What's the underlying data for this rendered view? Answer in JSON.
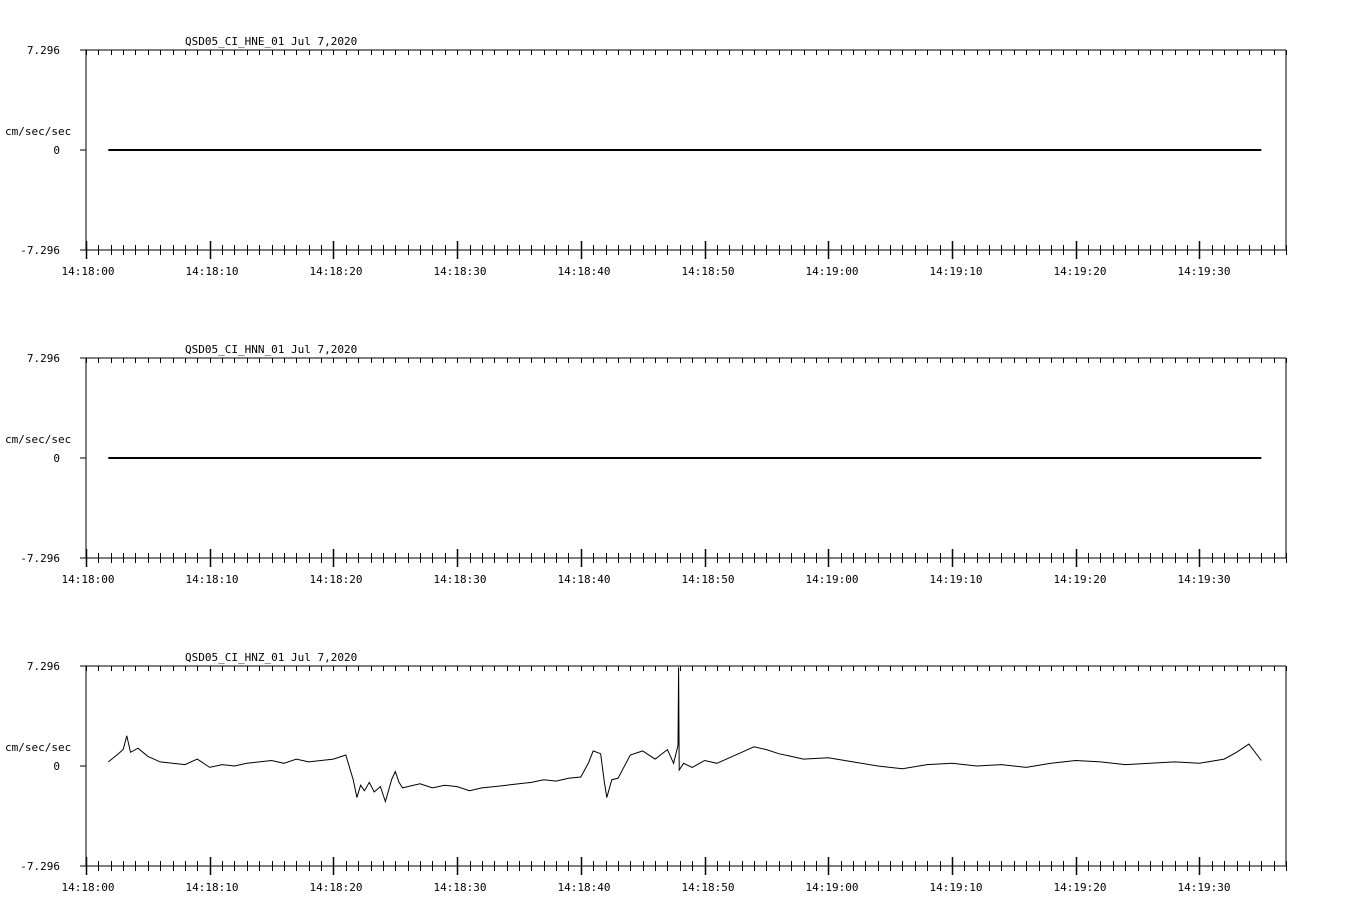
{
  "chart_data": [
    {
      "type": "line",
      "title": "QSD05_CI_HNE_01  Jul 7,2020",
      "ylabel": "cm/sec/sec",
      "y_tick_labels": [
        "7.296",
        "0",
        "-7.296"
      ],
      "ylim": [
        -7.296,
        7.296
      ],
      "x_tick_labels": [
        "14:18:00",
        "14:18:10",
        "14:18:20",
        "14:18:30",
        "14:18:40",
        "14:18:50",
        "14:19:00",
        "14:19:10",
        "14:19:20",
        "14:19:30"
      ],
      "x_range_s": [
        0,
        97
      ],
      "series": [
        {
          "x": [
            1.8,
            95.0
          ],
          "y": [
            0,
            0
          ]
        }
      ],
      "line_color": "#000000",
      "grid": false
    },
    {
      "type": "line",
      "title": "QSD05_CI_HNN_01  Jul 7,2020",
      "ylabel": "cm/sec/sec",
      "y_tick_labels": [
        "7.296",
        "0",
        "-7.296"
      ],
      "ylim": [
        -7.296,
        7.296
      ],
      "x_tick_labels": [
        "14:18:00",
        "14:18:10",
        "14:18:20",
        "14:18:30",
        "14:18:40",
        "14:18:50",
        "14:19:00",
        "14:19:10",
        "14:19:20",
        "14:19:30"
      ],
      "x_range_s": [
        0,
        97
      ],
      "series": [
        {
          "x": [
            1.8,
            95.0
          ],
          "y": [
            0,
            0
          ]
        }
      ],
      "line_color": "#000000",
      "grid": false
    },
    {
      "type": "line",
      "title": "QSD05_CI_HNZ_01  Jul 7,2020",
      "ylabel": "cm/sec/sec",
      "y_tick_labels": [
        "7.296",
        "0",
        "-7.296"
      ],
      "ylim": [
        -7.296,
        7.296
      ],
      "x_tick_labels": [
        "14:18:00",
        "14:18:10",
        "14:18:20",
        "14:18:30",
        "14:18:40",
        "14:18:50",
        "14:19:00",
        "14:19:10",
        "14:19:20",
        "14:19:30"
      ],
      "x_range_s": [
        0,
        97
      ],
      "series": [
        {
          "x": [
            1.8,
            2.5,
            3.0,
            3.3,
            3.6,
            4.2,
            5.0,
            6.0,
            7.0,
            8.0,
            9.0,
            10.0,
            11.0,
            12.0,
            13.0,
            14.0,
            15.0,
            16.0,
            17.0,
            18.0,
            19.0,
            20.0,
            21.0,
            21.6,
            21.9,
            22.2,
            22.5,
            22.9,
            23.3,
            23.8,
            24.2,
            24.7,
            25.0,
            25.3,
            25.6,
            26.0,
            27.0,
            28.0,
            29.0,
            30.0,
            31.0,
            32.0,
            33.0,
            34.0,
            35.0,
            36.0,
            37.0,
            38.0,
            39.0,
            40.0,
            40.6,
            41.0,
            41.6,
            41.9,
            42.1,
            42.5,
            43.0,
            44.0,
            45.0,
            46.0,
            47.0,
            47.5,
            47.85,
            47.9,
            47.95,
            48.3,
            49.0,
            50.0,
            51.0,
            52.0,
            53.0,
            54.0,
            55.0,
            56.0,
            57.0,
            58.0,
            60.0,
            62.0,
            64.0,
            66.0,
            68.0,
            70.0,
            72.0,
            74.0,
            76.0,
            78.0,
            80.0,
            82.0,
            84.0,
            86.0,
            88.0,
            90.0,
            92.0,
            93.0,
            94.0,
            95.0
          ],
          "y": [
            0.3,
            0.8,
            1.2,
            2.2,
            1.0,
            1.3,
            0.7,
            0.3,
            0.2,
            0.1,
            0.5,
            -0.1,
            0.1,
            0.0,
            0.2,
            0.3,
            0.4,
            0.2,
            0.5,
            0.3,
            0.4,
            0.5,
            0.8,
            -1.0,
            -2.3,
            -1.4,
            -1.8,
            -1.2,
            -1.9,
            -1.5,
            -2.6,
            -1.0,
            -0.4,
            -1.2,
            -1.6,
            -1.5,
            -1.3,
            -1.6,
            -1.4,
            -1.5,
            -1.8,
            -1.6,
            -1.5,
            -1.4,
            -1.3,
            -1.2,
            -1.0,
            -1.1,
            -0.9,
            -0.8,
            0.2,
            1.1,
            0.9,
            -1.2,
            -2.3,
            -1.0,
            -0.9,
            0.8,
            1.1,
            0.5,
            1.2,
            0.2,
            1.5,
            7.2,
            -0.3,
            0.2,
            -0.1,
            0.4,
            0.2,
            0.6,
            1.0,
            1.4,
            1.2,
            0.9,
            0.7,
            0.5,
            0.6,
            0.3,
            0.0,
            -0.2,
            0.1,
            0.2,
            0.0,
            0.1,
            -0.1,
            0.2,
            0.4,
            0.3,
            0.1,
            0.2,
            0.3,
            0.2,
            0.5,
            1.0,
            1.6,
            0.4
          ]
        }
      ],
      "line_color": "#000000",
      "grid": false
    }
  ]
}
